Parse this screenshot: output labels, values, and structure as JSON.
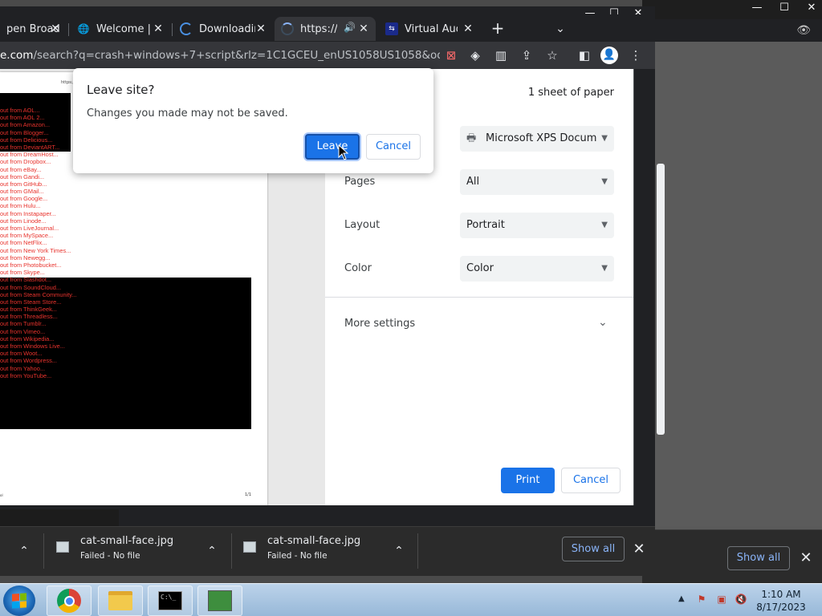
{
  "bg_window": {
    "show_all_label": "Show all",
    "close_glyph": "✕",
    "controls": [
      "—",
      "☐",
      "✕"
    ],
    "eye_glyph": "👁"
  },
  "chrome": {
    "window_controls": [
      "—",
      "☐",
      "✕"
    ],
    "tabs": [
      {
        "title": "pen Broad",
        "favicon": "none",
        "active": false
      },
      {
        "title": "Welcome | C",
        "favicon": "globe-icon",
        "active": false
      },
      {
        "title": "Downloadin",
        "favicon": "loading-arc-icon",
        "active": false
      },
      {
        "title": "https://",
        "favicon": "loading-spinner-icon",
        "active": true,
        "audio": true
      },
      {
        "title": "Virtual Audi",
        "favicon": "vb-audio-icon",
        "active": false
      }
    ],
    "new_tab_glyph": "+",
    "tab_search_glyph": "⌄",
    "url_host": "e.com",
    "url_rest": "/search?q=crash+windows+7+script&rlz=1C1GCEU_enUS1058US1058&oq=cras..."
  },
  "preview": {
    "page_url": "https://",
    "list_items": [
      "out from AOL...",
      "out from AOL 2...",
      "out from Amazon...",
      "out from Blogger...",
      "out from Delicious...",
      "out from DeviantART...",
      "out from DreamHost...",
      "out from Dropbox...",
      "out from eBay...",
      "out from Gandi...",
      "out from GitHub...",
      "out from GMail...",
      "out from Google...",
      "out from Hulu...",
      "out from Instapaper...",
      "out from Linode...",
      "out from LiveJournal...",
      "out from MySpace...",
      "out from NetFlix...",
      "out from New York Times...",
      "out from Newegg...",
      "out from Photobucket...",
      "out from Skype...",
      "out from Slashdot...",
      "out from SoundCloud...",
      "out from Steam Community...",
      "out from Steam Store...",
      "out from ThinkGeek...",
      "out from Threadless...",
      "out from Tumblr...",
      "out from Vimeo...",
      "out from Wikipedia...",
      "out from Windows Live...",
      "out from Woot...",
      "out from Wordpress...",
      "out from Yahoo...",
      "out from YouTube..."
    ],
    "footer_left": "ol",
    "footer_right": "1/1"
  },
  "print_settings": {
    "sheets": "1 sheet of paper",
    "destination": "Microsoft XPS Docum",
    "pages_label": "Pages",
    "pages_value": "All",
    "layout_label": "Layout",
    "layout_value": "Portrait",
    "color_label": "Color",
    "color_value": "Color",
    "more_settings": "More settings",
    "print_label": "Print",
    "cancel_label": "Cancel"
  },
  "dialog": {
    "title": "Leave site?",
    "message": "Changes you made may not be saved.",
    "leave_label": "Leave",
    "cancel_label": "Cancel"
  },
  "downloads": {
    "items": [
      {
        "name": "",
        "status": ""
      },
      {
        "name": "cat-small-face.jpg",
        "status": "Failed - No file"
      },
      {
        "name": "cat-small-face.jpg",
        "status": "Failed - No file"
      }
    ],
    "show_all_label": "Show all",
    "close_glyph": "✕",
    "chevron_glyph": "⌃"
  },
  "taskbar": {
    "time": "1:10 AM",
    "date": "8/17/2023",
    "cmd_text": "C:\\_"
  },
  "colors": {
    "accent": "#1a73e8",
    "preview_text_red": "#e8332d",
    "chrome_dark": "#202124"
  }
}
